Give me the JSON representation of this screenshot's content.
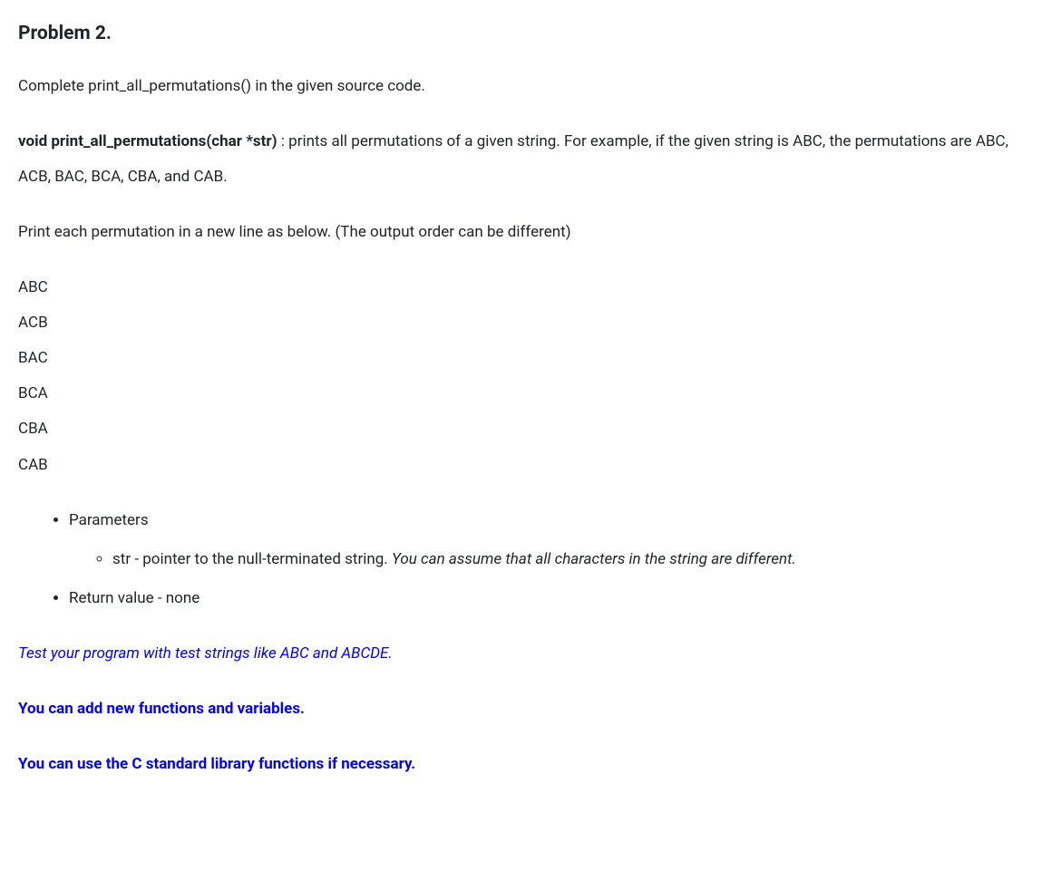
{
  "heading": "Problem 2.",
  "intro": "Complete print_all_permutations() in the given source code.",
  "func_sig": "void print_all_permutations(char *str)",
  "func_desc": " : prints all permutations of a given string. For example, if the given string is ABC, the permutations are ABC, ACB, BAC, BCA, CBA, and CAB.",
  "instruction": "Print each permutation in a new line as below. (The output order can be different)",
  "outputs": [
    "ABC",
    "ACB",
    "BAC",
    "BCA",
    "CBA",
    "CAB"
  ],
  "params_label": "Parameters",
  "param_str_prefix": "str - pointer to the null-terminated string. ",
  "param_str_italic": "You can assume that all characters in the string are different.",
  "return_label": "Return value - none",
  "note_test": "Test your program with test strings like ABC and ABCDE.",
  "note_add": "You can add new functions and variables.",
  "note_lib": "You can use the C standard library functions if necessary."
}
